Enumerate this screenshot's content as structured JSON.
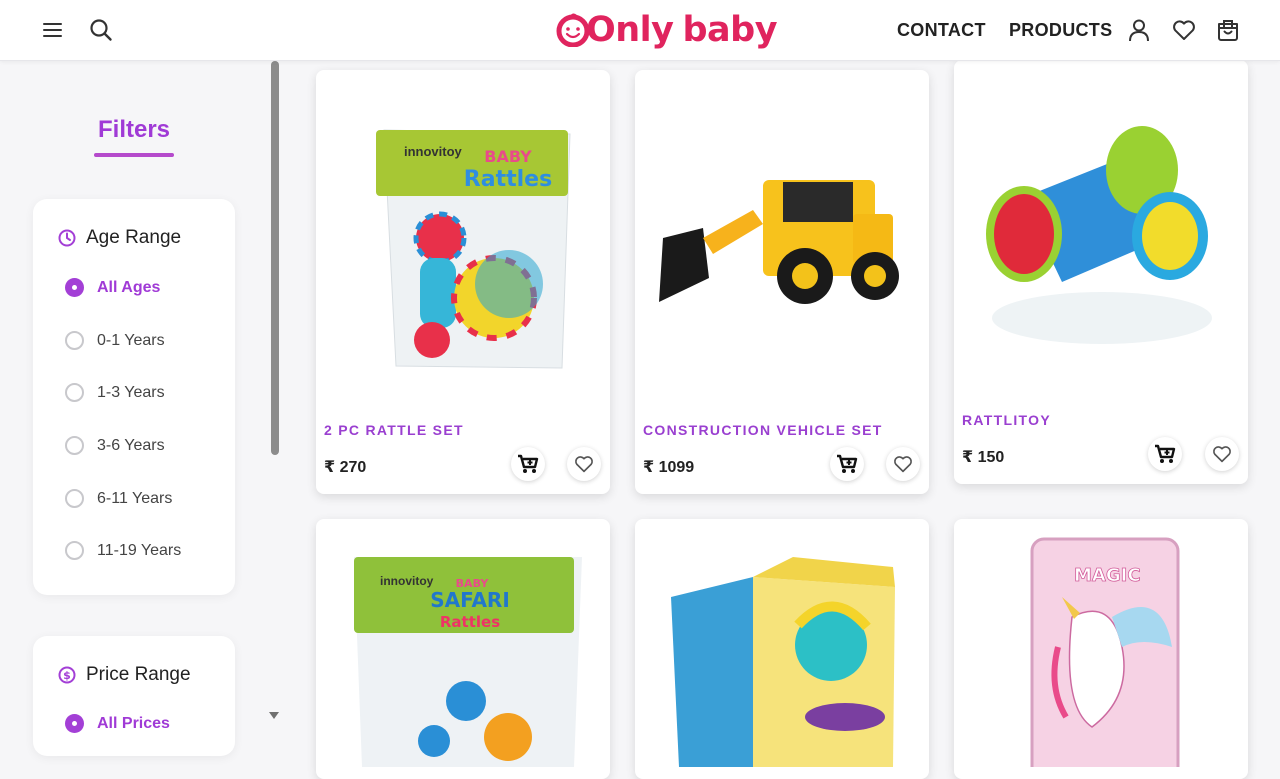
{
  "header": {
    "logo_text_a": "Only",
    "logo_text_b": "baby",
    "nav": {
      "contact": "CONTACT",
      "products": "PRODUCTS"
    },
    "icons": [
      "menu-icon",
      "search-icon",
      "user-icon",
      "heart-icon",
      "cart-icon"
    ]
  },
  "filters": {
    "title": "Filters",
    "age": {
      "heading": "Age Range",
      "options": [
        {
          "label": "All Ages",
          "selected": true
        },
        {
          "label": "0-1 Years",
          "selected": false
        },
        {
          "label": "1-3 Years",
          "selected": false
        },
        {
          "label": "3-6 Years",
          "selected": false
        },
        {
          "label": "6-11 Years",
          "selected": false
        },
        {
          "label": "11-19 Years",
          "selected": false
        }
      ]
    },
    "price": {
      "heading": "Price Range",
      "options": [
        {
          "label": "All Prices",
          "selected": true
        }
      ]
    }
  },
  "products": [
    {
      "name": "2 PC RATTLE SET",
      "price": "₹ 270"
    },
    {
      "name": "CONSTRUCTION VEHICLE SET",
      "price": "₹ 1099"
    },
    {
      "name": "RATTLITOY",
      "price": "₹ 150"
    },
    {
      "name": "",
      "price": ""
    },
    {
      "name": "",
      "price": ""
    },
    {
      "name": "",
      "price": ""
    }
  ],
  "product_image_text": {
    "brand": "innovitoy",
    "p1_label_a": "BABY",
    "p1_label_b": "Rattles",
    "p4_label_a": "BABY",
    "p4_label_b": "SAFARI",
    "p4_label_c": "Rattles",
    "p6_label": "MAGIC"
  },
  "colors": {
    "accent": "#a03ad6",
    "logo": "#e0245e"
  }
}
